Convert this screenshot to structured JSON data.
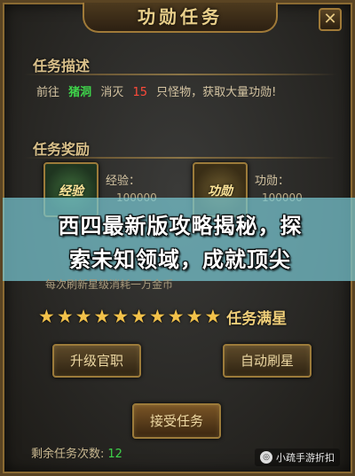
{
  "window": {
    "title": "功勋任务",
    "close_glyph": "✕"
  },
  "description": {
    "heading": "任务描述",
    "go_word": "前往",
    "location": "猪洞",
    "kill_word": "消灭",
    "count": "15",
    "rest": "只怪物，获取大量功勋!"
  },
  "rewards": {
    "heading": "任务奖励",
    "exp_icon": "经验",
    "exp_label": "经验：",
    "exp_value": "100000",
    "merit_icon": "功勋",
    "merit_label": "功勋：",
    "merit_value": "100000"
  },
  "banner": {
    "line1": "西四最新版攻略揭秘，探",
    "line2": "索未知领域，成就顶尖",
    "subtext": "每次刷新星级消耗一万金币"
  },
  "stars": {
    "count": 10,
    "label": "任务满星",
    "glyph": "★"
  },
  "buttons": {
    "upgrade": "升级官职",
    "auto_refresh": "自动刷星",
    "accept": "接受任务"
  },
  "remaining": {
    "label": "剩余任务次数:",
    "value": "12"
  },
  "watermark": {
    "text": "小疏手游折扣"
  },
  "colors": {
    "accent": "#e9cf8a",
    "green": "#3ed24a",
    "red": "#ff4a3a",
    "banner": "#78c8d2"
  }
}
